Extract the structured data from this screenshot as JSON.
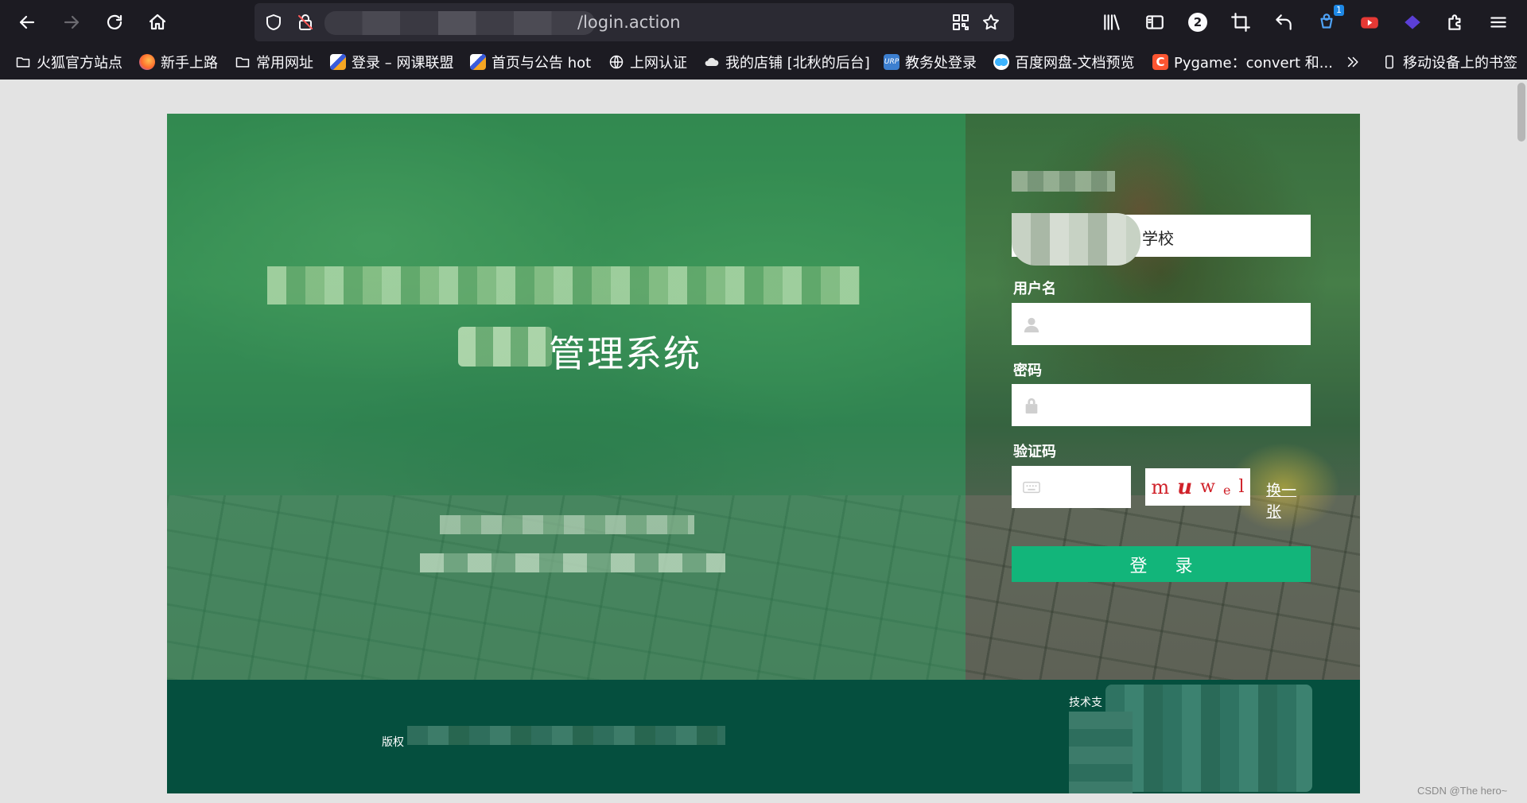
{
  "browser": {
    "url_visible": "/login.action",
    "ext_badge_count": "1",
    "tab_count_badge": "2"
  },
  "bookmarks": [
    {
      "label": "火狐官方站点",
      "icon": "folder-icon"
    },
    {
      "label": "新手上路",
      "icon": "firefox-icon"
    },
    {
      "label": "常用网址",
      "icon": "folder-icon"
    },
    {
      "label": "登录 – 网课联盟",
      "icon": "site-favicon"
    },
    {
      "label": "首页与公告 hot",
      "icon": "site-favicon"
    },
    {
      "label": "上网认证",
      "icon": "globe-icon"
    },
    {
      "label": "我的店铺 [北秋的后台]",
      "icon": "cloud-icon"
    },
    {
      "label": "教务处登录",
      "icon": "urp-icon"
    },
    {
      "label": "百度网盘-文档预览",
      "icon": "baidu-pan-icon"
    },
    {
      "label": "Pygame：convert 和...",
      "icon": "csdn-icon"
    },
    {
      "label": "移动设备上的书签",
      "icon": "mobile-icon"
    }
  ],
  "hero": {
    "title": "管理系统"
  },
  "form": {
    "school_value": "学校",
    "username_label": "用户名",
    "password_label": "密码",
    "captcha_label": "验证码",
    "captcha_chars": [
      "m",
      "u",
      "w",
      "e",
      "l"
    ],
    "refresh_label": "换一张",
    "login_label": "登 录"
  },
  "footer": {
    "copyright_label": "版权",
    "tech_label": "技术支"
  },
  "watermark": "CSDN @The hero~",
  "colors": {
    "login_button": "#12b57a",
    "footer": "#054f3e",
    "overlay": "#28965a",
    "captcha_text": "#d0222a"
  }
}
